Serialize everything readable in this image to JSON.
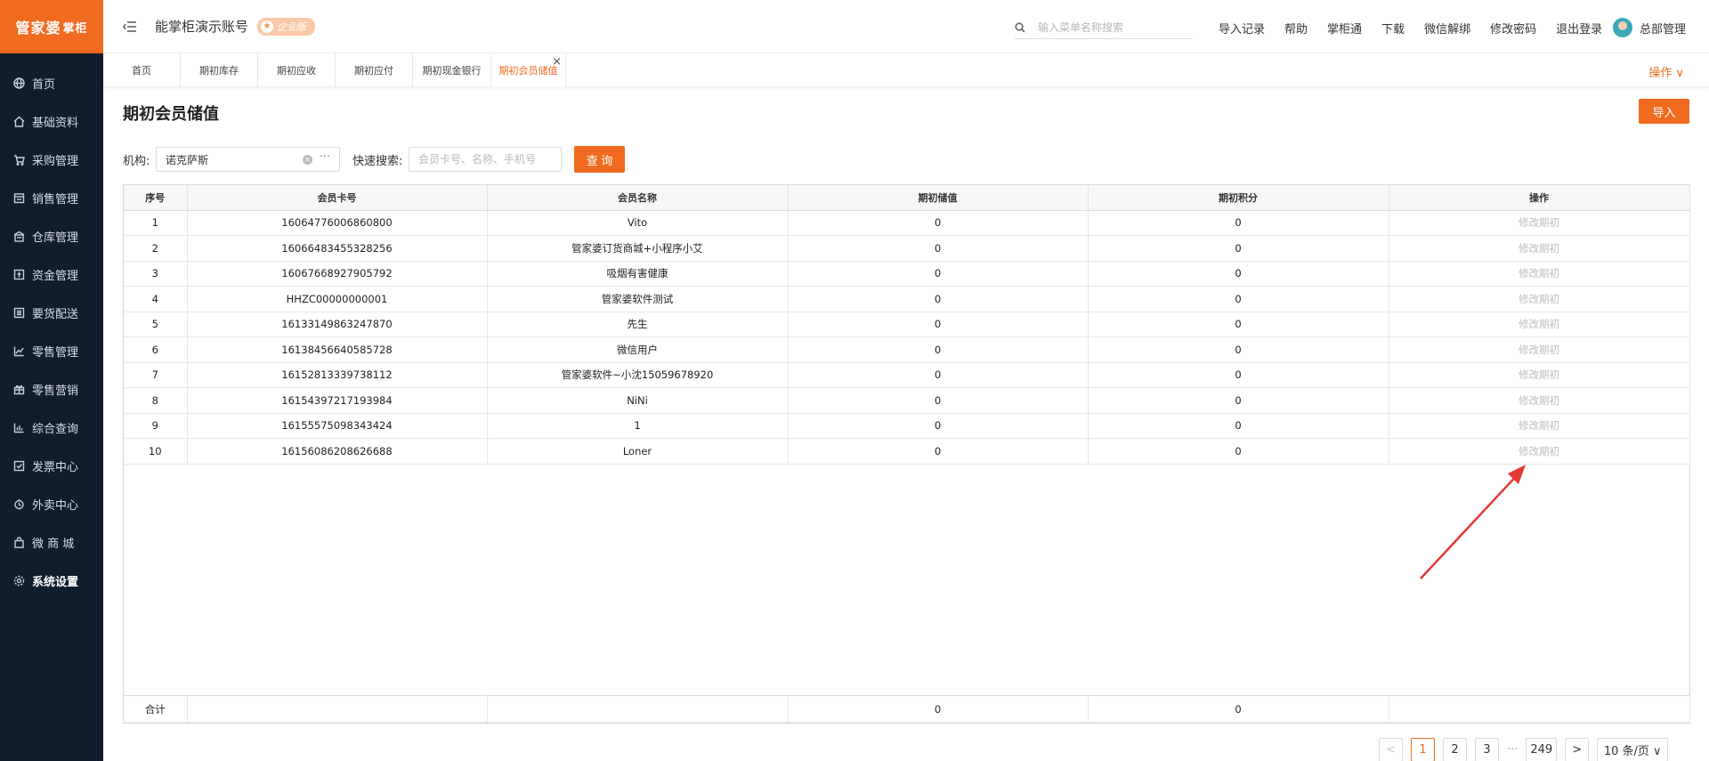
{
  "sidebar": {
    "logo_main": "管家婆",
    "logo_sub": "掌柜",
    "items": [
      {
        "label": "首页",
        "icon": "globe-icon"
      },
      {
        "label": "基础资料",
        "icon": "home-icon"
      },
      {
        "label": "采购管理",
        "icon": "cart-icon"
      },
      {
        "label": "销售管理",
        "icon": "sales-icon"
      },
      {
        "label": "仓库管理",
        "icon": "warehouse-icon"
      },
      {
        "label": "资金管理",
        "icon": "money-icon"
      },
      {
        "label": "要货配送",
        "icon": "list-icon"
      },
      {
        "label": "零售管理",
        "icon": "chart-icon"
      },
      {
        "label": "零售营销",
        "icon": "gift-icon"
      },
      {
        "label": "综合查询",
        "icon": "bar-chart-icon"
      },
      {
        "label": "发票中心",
        "icon": "invoice-icon"
      },
      {
        "label": "外卖中心",
        "icon": "delivery-icon"
      },
      {
        "label": "微 商 城",
        "icon": "bag-icon"
      },
      {
        "label": "系统设置",
        "icon": "gear-icon"
      }
    ]
  },
  "header": {
    "account_name": "能掌柜演示账号",
    "edition_badge": "企业版",
    "search_placeholder": "输入菜单名称搜索",
    "links": [
      "导入记录",
      "帮助",
      "掌柜通",
      "下载",
      "微信解绑",
      "修改密码",
      "退出登录"
    ],
    "user_name": "总部管理"
  },
  "tabs": [
    {
      "label": "首页"
    },
    {
      "label": "期初库存"
    },
    {
      "label": "期初应收"
    },
    {
      "label": "期初应付"
    },
    {
      "label": "期初现金银行"
    },
    {
      "label": "期初会员储值",
      "active": true
    }
  ],
  "tab_ops_label": "操作 ∨",
  "page": {
    "title": "期初会员储值",
    "import_label": "导入",
    "org_label": "机构:",
    "org_value": "诺克萨斯",
    "quick_search_label": "快速搜索:",
    "quick_search_placeholder": "会员卡号、名称、手机号",
    "query_label": "查 询"
  },
  "table": {
    "columns": [
      "序号",
      "会员卡号",
      "会员名称",
      "期初储值",
      "期初积分",
      "操作"
    ],
    "rows": [
      {
        "no": "1",
        "card": "16064776006860800",
        "name": "Vito",
        "stored": "0",
        "points": "0",
        "op": "修改期初"
      },
      {
        "no": "2",
        "card": "16066483455328256",
        "name": "管家婆订货商城+小程序小艾",
        "stored": "0",
        "points": "0",
        "op": "修改期初"
      },
      {
        "no": "3",
        "card": "16067668927905792",
        "name": "吸烟有害健康",
        "stored": "0",
        "points": "0",
        "op": "修改期初"
      },
      {
        "no": "4",
        "card": "HHZC00000000001",
        "name": "管家婆软件测试",
        "stored": "0",
        "points": "0",
        "op": "修改期初"
      },
      {
        "no": "5",
        "card": "16133149863247870",
        "name": "先生",
        "stored": "0",
        "points": "0",
        "op": "修改期初"
      },
      {
        "no": "6",
        "card": "16138456640585728",
        "name": "微信用户",
        "stored": "0",
        "points": "0",
        "op": "修改期初"
      },
      {
        "no": "7",
        "card": "16152813339738112",
        "name": "管家婆软件~小沈15059678920",
        "stored": "0",
        "points": "0",
        "op": "修改期初"
      },
      {
        "no": "8",
        "card": "16154397217193984",
        "name": "NiNi",
        "stored": "0",
        "points": "0",
        "op": "修改期初"
      },
      {
        "no": "9",
        "card": "16155575098343424",
        "name": "1",
        "stored": "0",
        "points": "0",
        "op": "修改期初"
      },
      {
        "no": "10",
        "card": "16156086208626688",
        "name": "Loner",
        "stored": "0",
        "points": "0",
        "op": "修改期初"
      }
    ],
    "total": {
      "label": "合计",
      "stored": "0",
      "points": "0"
    }
  },
  "pagination": {
    "prev": "<",
    "pages": [
      "1",
      "2",
      "3"
    ],
    "current": "1",
    "ellipsis": "···",
    "last": "249",
    "next": ">",
    "page_size": "10 条/页 ∨"
  },
  "colors": {
    "brand": "#f06a1f",
    "sidebar_bg": "#0f1d2f",
    "annotation_arrow": "#e53935"
  }
}
